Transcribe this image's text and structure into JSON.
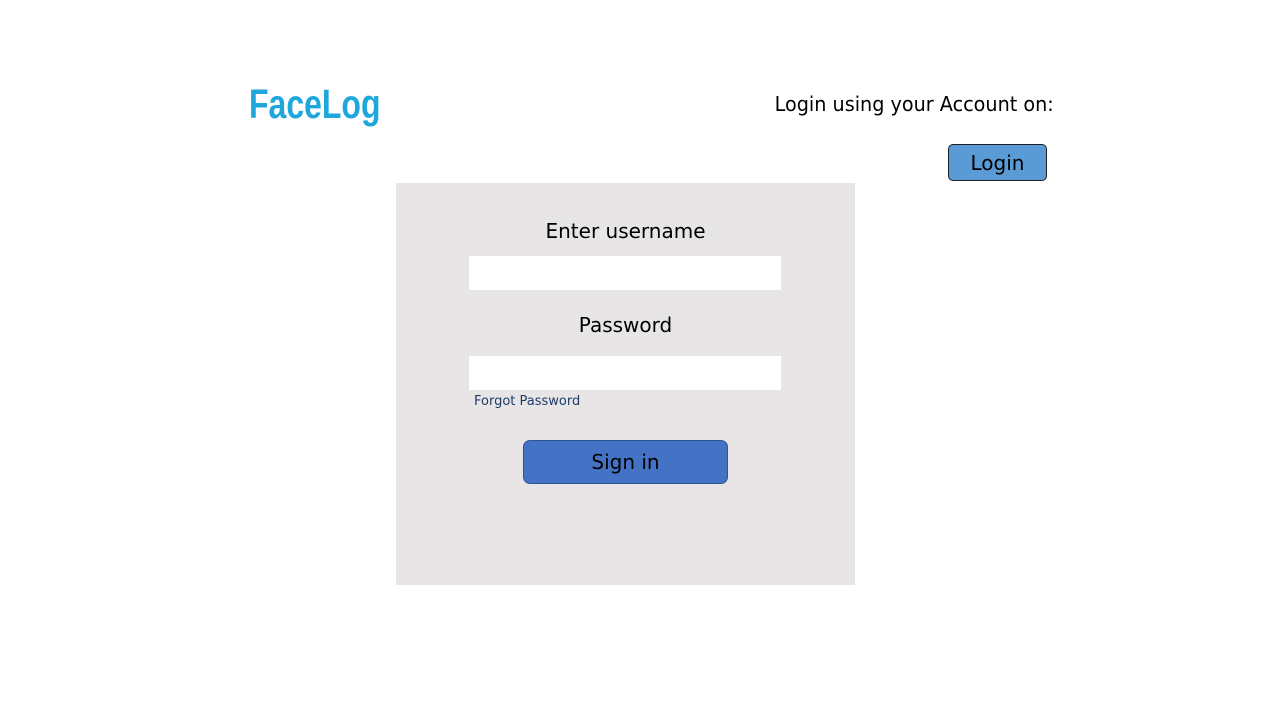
{
  "header": {
    "logo_text": "FaceLog",
    "account_prompt": "Login using your Account on:",
    "login_button_label": "Login"
  },
  "login_form": {
    "username_label": "Enter username",
    "username_value": "",
    "password_label": "Password",
    "password_value": "",
    "forgot_password_label": "Forgot Password",
    "sign_in_label": "Sign in"
  },
  "colors": {
    "logo": "#1ea7dd",
    "login_button": "#5b9bd5",
    "panel_background": "#e7e5e6",
    "sign_in_button": "#4472c4",
    "link": "#1f3c66"
  }
}
